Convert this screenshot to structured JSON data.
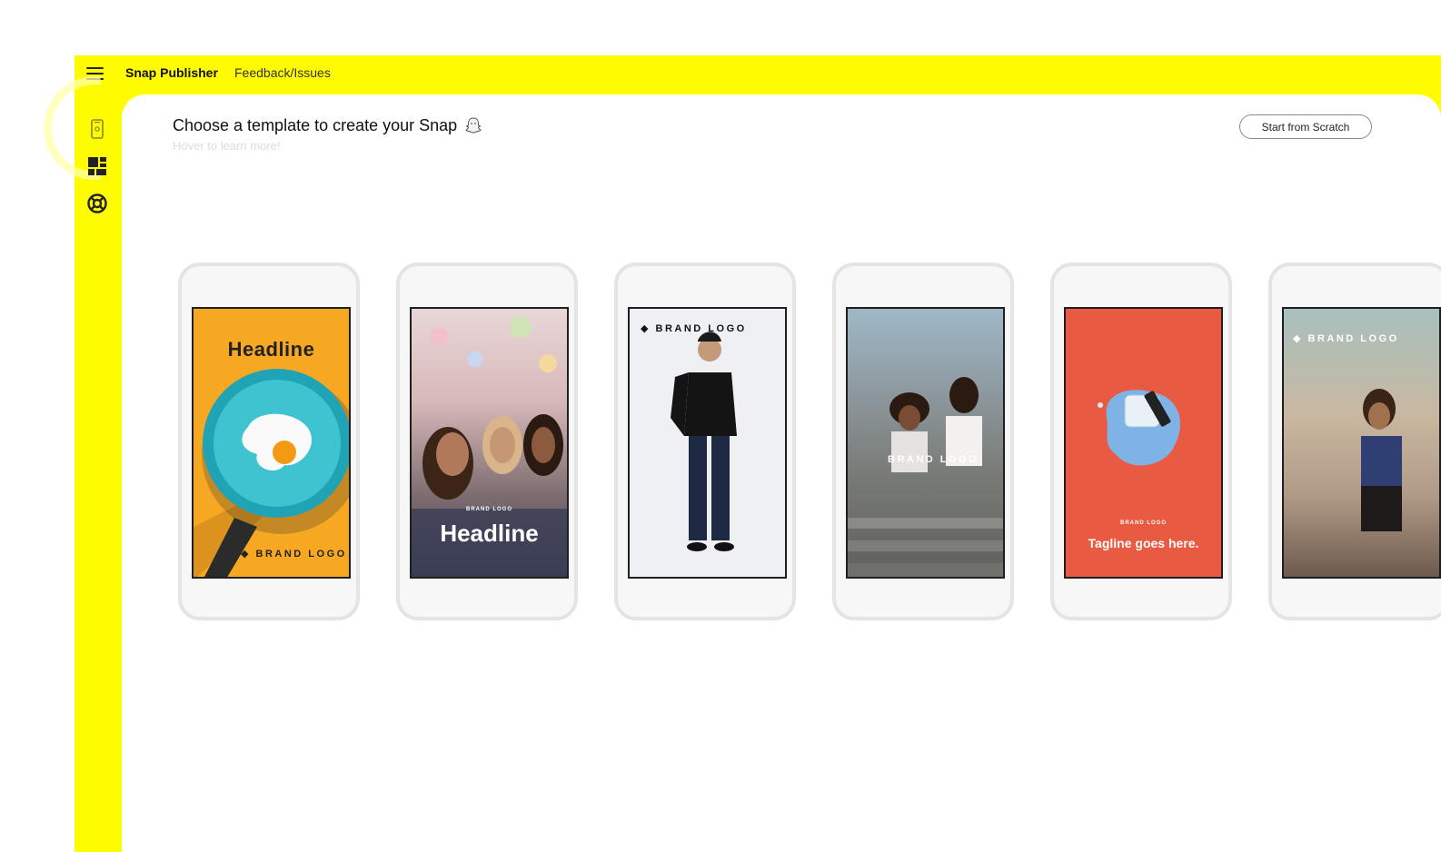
{
  "topbar": {
    "app_name": "Snap Publisher",
    "feedback_link": "Feedback/Issues"
  },
  "sidebar": {
    "items": [
      {
        "icon": "phone-icon"
      },
      {
        "icon": "dashboard-icon"
      },
      {
        "icon": "lifebuoy-icon"
      }
    ]
  },
  "main": {
    "title": "Choose a template to create your Snap",
    "subtitle": "Hover to learn more!",
    "start_button": "Start from Scratch"
  },
  "templates": [
    {
      "headline": "Headline",
      "logo": "BRAND LOGO",
      "bg": "#F7A823"
    },
    {
      "logo": "BRAND LOGO",
      "headline": "Headline"
    },
    {
      "logo": "BRAND LOGO"
    },
    {
      "logo": "BRAND LOGO"
    },
    {
      "logo": "BRAND LOGO",
      "tagline": "Tagline goes here.",
      "bg": "#E95A42"
    },
    {
      "logo": "BRAND LOGO"
    }
  ],
  "colors": {
    "brand_yellow": "#FFFC00",
    "accent_orange": "#F7A823",
    "accent_red": "#E95A42"
  }
}
